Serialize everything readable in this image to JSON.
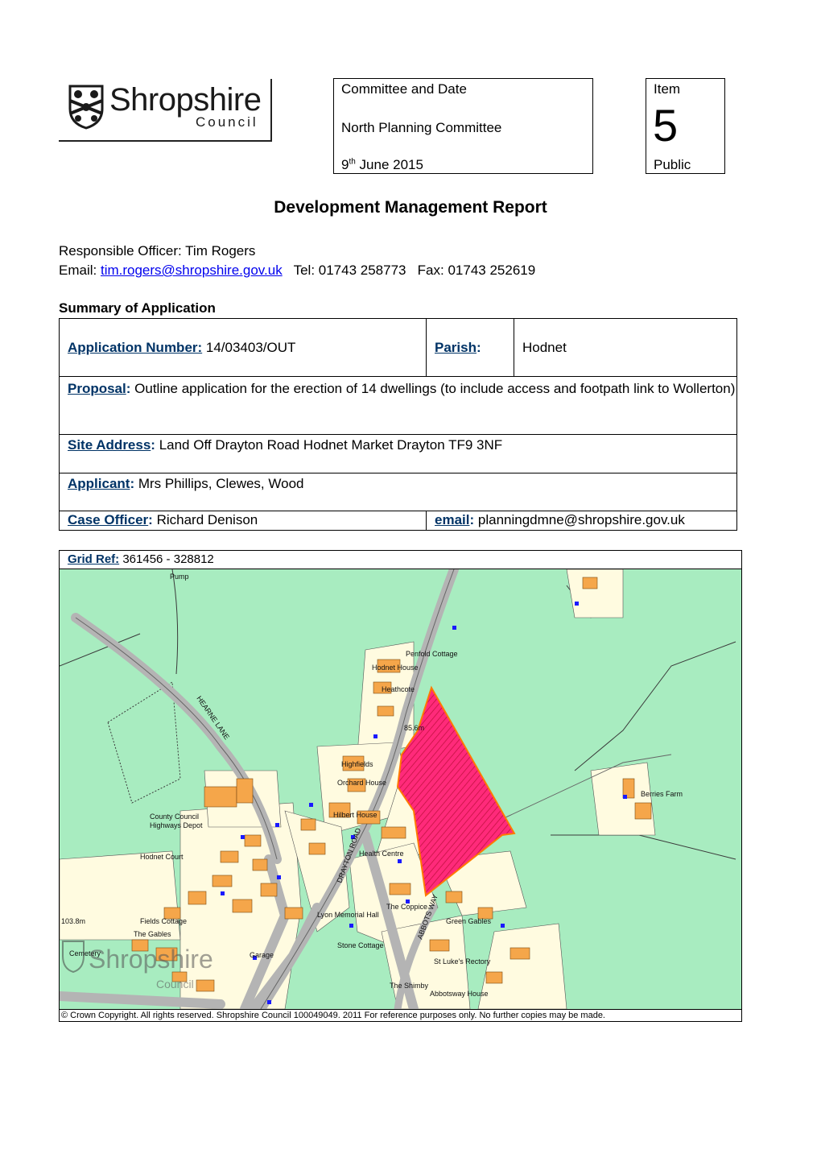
{
  "logo": {
    "name": "Shropshire",
    "sub": "Council"
  },
  "committee": {
    "heading": "Committee and Date",
    "name": "North Planning Committee",
    "day": "9",
    "day_suffix": "th",
    "date_rest": " June 2015"
  },
  "item": {
    "label": "Item",
    "number": "5",
    "status": "Public"
  },
  "title": "Development Management Report",
  "officer": {
    "label": "Responsible Officer: Tim Rogers",
    "email_label": "Email: ",
    "email": "tim.rogers@shropshire.gov.uk",
    "tel": "Tel: 01743 258773",
    "fax": "Fax: 01743 252619"
  },
  "summary": {
    "heading": "Summary of Application",
    "app_number_label": "Application Number:",
    "app_number": " 14/03403/OUT",
    "parish_label": "Parish",
    "parish_colon": ":",
    "parish": "Hodnet",
    "proposal_label": "Proposal",
    "proposal_colon": ":",
    "proposal": " Outline application for the erection of 14 dwellings (to include access and footpath link to Wollerton)",
    "site_label": "Site Address",
    "site_colon": ":",
    "site": " Land Off Drayton Road Hodnet Market Drayton TF9 3NF",
    "applicant_label": "Applicant",
    "applicant_colon": ":",
    "applicant": " Mrs Phillips, Clewes, Wood",
    "case_label": "Case Officer",
    "case_colon": ":",
    "case": " Richard Denison",
    "email_label": "email",
    "email_colon": ":",
    "email": " planningdmne@shropshire.gov.uk"
  },
  "map": {
    "grid_label": "Grid Ref:",
    "grid_value": " 361456 - 328812",
    "labels": {
      "pump": "Pump",
      "penfold": "Penfold Cottage",
      "hodnet_house": "Hodnet House",
      "heathcote": "Heathcote",
      "height": "85.6m",
      "hearne_lane": "HEARNE LANE",
      "highfields": "Highfields",
      "orchard": "Orchard House",
      "county_council": "County Council",
      "highways": "Highways Depot",
      "berries": "Berries Farm",
      "hilbert": "Hilbert House",
      "drayton_road": "DRAYTON ROAD",
      "health": "Health Centre",
      "hodnet_court": "Hodnet Court",
      "the_coppice": "The Coppice",
      "green_gables": "Green Gables",
      "fields_cottage": "Fields Cottage",
      "the_gables": "The Gables",
      "lyon": "Lyon Memorial Hall",
      "height2": "103.8m",
      "cemetery": "Cemetery",
      "garage": "Garage",
      "stone": "Stone Cottage",
      "st_lukes": "St Luke's Rectory",
      "abbots_way": "ABBOTS WAY",
      "shimby": "The Shimby",
      "abbotsway_house": "Abbotsway House",
      "watermark": "Shropshire",
      "watermark_sub": "Council"
    },
    "colors": {
      "field": "#a8ecc0",
      "road": "#b4b4b4",
      "building": "#f5a64a",
      "plot": "#fffbe0",
      "site": "#ff2a7a",
      "site_border": "#ff7a00"
    }
  },
  "copyright": "© Crown Copyright. All rights reserved.  Shropshire Council 100049049. 2011 For reference purposes only. No further copies may be made."
}
